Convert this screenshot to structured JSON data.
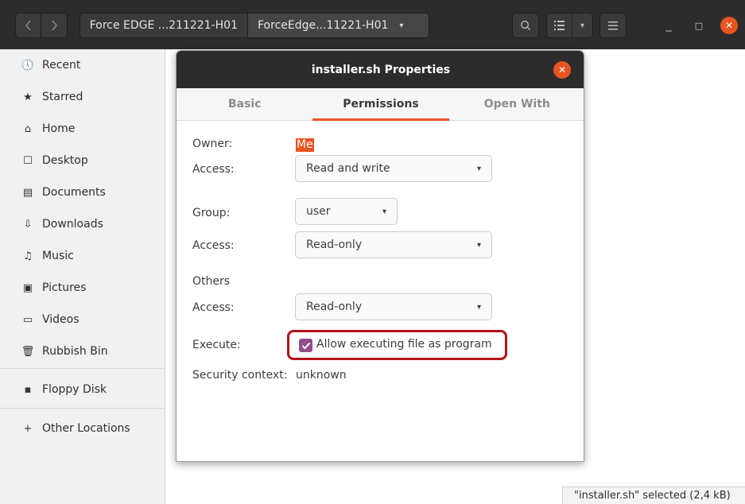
{
  "window": {
    "nav_back_icon": "chevron-left-icon",
    "nav_forward_icon": "chevron-right-icon",
    "path_first": "Force EDGE ...211221-H01",
    "path_second": "ForceEdge...11221-H01",
    "path_second_caret": "▾",
    "search_icon": "search-icon",
    "view_icon": "list-view-icon",
    "view_caret": "▾",
    "menu_icon": "hamburger-menu-icon",
    "minimize": "_",
    "maximize": "□",
    "close": "✕"
  },
  "sidebar": {
    "items": [
      {
        "icon": "🕔",
        "label": "Recent"
      },
      {
        "icon": "★",
        "label": "Starred"
      },
      {
        "icon": "⌂",
        "label": "Home"
      },
      {
        "icon": "☐",
        "label": "Desktop"
      },
      {
        "icon": "▤",
        "label": "Documents"
      },
      {
        "icon": "⇩",
        "label": "Downloads"
      },
      {
        "icon": "♫",
        "label": "Music"
      },
      {
        "icon": "▣",
        "label": "Pictures"
      },
      {
        "icon": "▭",
        "label": "Videos"
      },
      {
        "icon": "🗑",
        "label": "Rubbish Bin"
      },
      {
        "icon": "▪",
        "label": "Floppy Disk"
      },
      {
        "icon": "+",
        "label": "Other Locations"
      }
    ]
  },
  "status": {
    "text": "\"installer.sh\" selected  (2,4 kB)"
  },
  "dialog": {
    "title": "installer.sh Properties",
    "close": "✕",
    "tabs": [
      {
        "label": "Basic",
        "active": false
      },
      {
        "label": "Permissions",
        "active": true
      },
      {
        "label": "Open With",
        "active": false
      }
    ],
    "owner_label": "Owner:",
    "owner_value": "Me",
    "owner_access_label": "Access:",
    "owner_access_value": "Read and write",
    "group_label": "Group:",
    "group_value": "user",
    "group_access_label": "Access:",
    "group_access_value": "Read-only",
    "others_label": "Others",
    "others_access_label": "Access:",
    "others_access_value": "Read-only",
    "execute_label": "Execute:",
    "execute_checkbox_label": "Allow executing file as program",
    "execute_checked": true,
    "security_label": "Security context:",
    "security_value": "unknown",
    "combo_caret": "▾"
  },
  "colors": {
    "accent": "#e95420",
    "checkbox": "#924d8b",
    "highlight_box": "#b5121b",
    "headerbar": "#2c2c2c"
  }
}
